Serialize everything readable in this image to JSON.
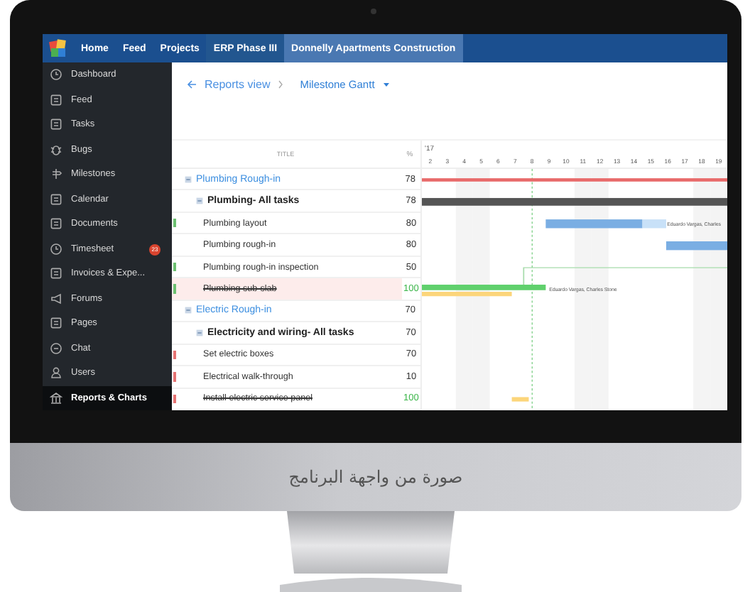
{
  "nav": {
    "items": [
      {
        "label": "Home",
        "kind": "link",
        "selected": false
      },
      {
        "label": "Feed",
        "kind": "link",
        "selected": false
      },
      {
        "label": "Projects",
        "kind": "link",
        "selected": false
      },
      {
        "label": "ERP Phase III",
        "kind": "project",
        "selected": false
      },
      {
        "label": "Donnelly Apartments Construction",
        "kind": "project",
        "selected": true
      }
    ]
  },
  "sidebar": {
    "items": [
      {
        "label": "Dashboard",
        "selected": false
      },
      {
        "label": "Feed",
        "selected": false
      },
      {
        "label": "Tasks",
        "selected": false
      },
      {
        "label": "Bugs",
        "selected": false
      },
      {
        "label": "Milestones",
        "selected": false
      },
      {
        "label": "Calendar",
        "selected": false
      },
      {
        "label": "Documents",
        "selected": false
      },
      {
        "label": "Timesheet",
        "selected": false,
        "badge": "23"
      },
      {
        "label": "Invoices & Expe...",
        "selected": false
      },
      {
        "label": "Forums",
        "selected": false
      },
      {
        "label": "Pages",
        "selected": false
      },
      {
        "label": "Chat",
        "selected": false
      },
      {
        "label": "Users",
        "selected": false
      },
      {
        "label": "Reports & Charts",
        "selected": true
      }
    ]
  },
  "breadcrumb": {
    "parent": "Reports view",
    "current": "Milestone Gantt"
  },
  "table": {
    "columns": [
      "TITLE",
      "%"
    ],
    "month": "'17",
    "days": [
      "2",
      "3",
      "4",
      "5",
      "6",
      "7",
      "8",
      "9",
      "10",
      "11",
      "12",
      "13",
      "14",
      "15",
      "16",
      "17",
      "18",
      "19"
    ],
    "rows": [
      {
        "title": "Plumbing Rough-in",
        "percent": "78",
        "expanded": true,
        "children": [
          {
            "title": "Plumbing- All tasks",
            "percent": "78",
            "expanded": true,
            "children": [
              {
                "title": "Plumbing layout",
                "percent": "80",
                "color": "#6cc070",
                "done": false,
                "highlighted": false,
                "assignees": "Eduardo Vargas, Charles"
              },
              {
                "title": "Plumbing rough-in",
                "percent": "80",
                "done": false,
                "highlighted": false
              },
              {
                "title": "Plumbing rough-in inspection",
                "percent": "50",
                "color": "#6cc070",
                "done": false,
                "highlighted": false
              },
              {
                "title": "Plumbing sub-slab",
                "percent": "100",
                "color": "#6cc070",
                "done": true,
                "highlighted": true,
                "assignees": "Eduardo Vargas, Charles Stone"
              }
            ]
          }
        ]
      },
      {
        "title": "Electric Rough-in",
        "percent": "70",
        "expanded": true,
        "children": [
          {
            "title": "Electricity and wiring- All tasks",
            "percent": "70",
            "expanded": true,
            "children": [
              {
                "title": "Set electric boxes",
                "percent": "70",
                "color": "#e57373",
                "done": false,
                "highlighted": false
              },
              {
                "title": "Electrical walk-through",
                "percent": "10",
                "color": "#e57373",
                "done": false,
                "highlighted": false
              },
              {
                "title": "Install electric service panel",
                "percent": "100",
                "color": "#e57373",
                "done": true,
                "highlighted": false
              }
            ]
          }
        ]
      }
    ]
  },
  "caption": "صورة من واجهة البرنامج"
}
